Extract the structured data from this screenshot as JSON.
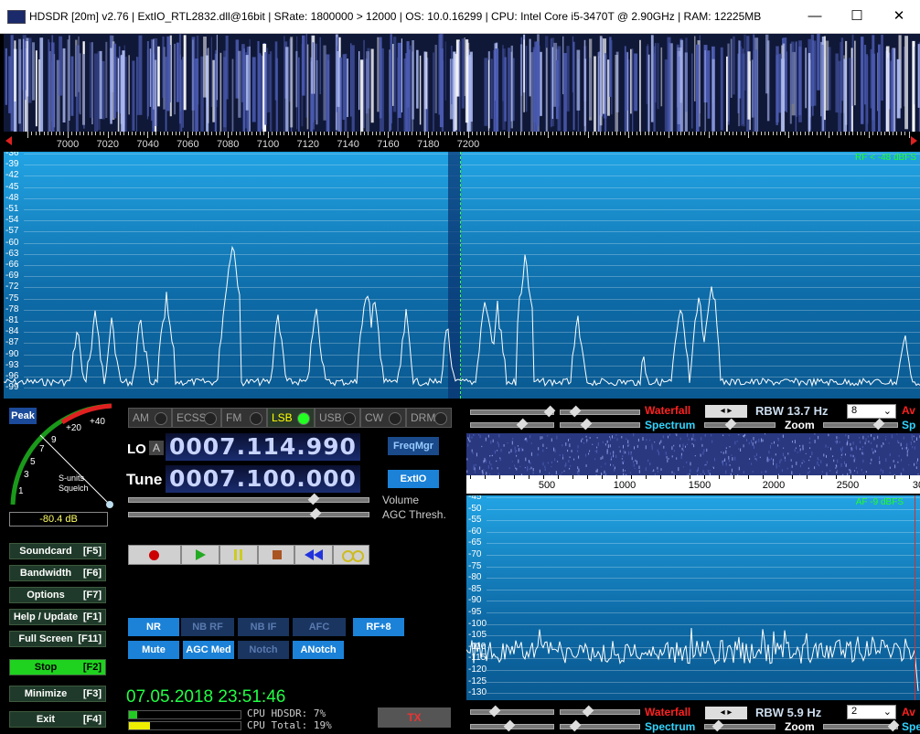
{
  "window": {
    "title": "HDSDR  [20m]  v2.76   |  ExtIO_RTL2832.dll@16bit  |  SRate: 1800000 > 12000  |  OS: 10.0.16299   |  CPU: Intel Core i5-3470T @ 2.90GHz  |  RAM: 12225MB",
    "minimize_glyph": "—",
    "maximize_glyph": "☐",
    "close_glyph": "✕"
  },
  "ruler": {
    "labels": [
      "7000",
      "7020",
      "7040",
      "7060",
      "7080",
      "7100",
      "7120",
      "7140",
      "7160",
      "7180",
      "7200"
    ]
  },
  "spectrum": {
    "rf_level": "RF < -48 dBFS",
    "db_labels": [
      "-36",
      "-39",
      "-42",
      "-45",
      "-48",
      "-51",
      "-54",
      "-57",
      "-60",
      "-63",
      "-66",
      "-69",
      "-72",
      "-75",
      "-78",
      "-81",
      "-84",
      "-87",
      "-90",
      "-93",
      "-96",
      "-99"
    ]
  },
  "smeter": {
    "peak_label": "Peak",
    "scale": [
      "1",
      "3",
      "5",
      "7",
      "9",
      "+20",
      "+40"
    ],
    "caption1": "S-units",
    "caption2": "Squelch",
    "reading": "-80.4 dB"
  },
  "modes": [
    {
      "label": "AM",
      "active": false
    },
    {
      "label": "ECSS",
      "active": false
    },
    {
      "label": "FM",
      "active": false
    },
    {
      "label": "LSB",
      "active": true
    },
    {
      "label": "USB",
      "active": false
    },
    {
      "label": "CW",
      "active": false
    },
    {
      "label": "DRM",
      "active": false
    }
  ],
  "lo": {
    "label": "LO",
    "mode": "A",
    "value": "0007.114.990"
  },
  "tune": {
    "label": "Tune",
    "value": "0007.100.000"
  },
  "buttons": {
    "freqmgr": "FreqMgr",
    "extio": "ExtIO",
    "volume": "Volume",
    "agc_thresh": "AGC Thresh."
  },
  "side_buttons": [
    {
      "label": "Soundcard",
      "key": "[F5]"
    },
    {
      "label": "Bandwidth",
      "key": "[F6]"
    },
    {
      "label": "Options",
      "key": "[F7]"
    },
    {
      "label": "Help / Update",
      "key": "[F1]"
    },
    {
      "label": "Full Screen",
      "key": "[F11]"
    },
    {
      "label": "Stop",
      "key": "[F2]"
    },
    {
      "label": "Minimize",
      "key": "[F3]"
    },
    {
      "label": "Exit",
      "key": "[F4]"
    }
  ],
  "dsp1": [
    "NR",
    "NB RF",
    "NB IF",
    "AFC",
    "RF+8"
  ],
  "dsp2": [
    "Mute",
    "AGC Med",
    "Notch",
    "ANotch"
  ],
  "datetime": "07.05.2018 23:51:46",
  "cpu": {
    "hdsdr": "CPU HDSDR: 7%",
    "total": "CPU Total: 19%",
    "hdsdr_fraction": 0.07,
    "total_fraction": 0.19
  },
  "tx_label": "TX",
  "top_controls": {
    "waterfall": "Waterfall",
    "spectrum": "Spectrum",
    "rbw": "RBW 13.7 Hz",
    "zoom": "Zoom",
    "select_value": "8",
    "av": "Av",
    "sp": "Sp"
  },
  "af": {
    "axis": [
      "500",
      "1000",
      "1500",
      "2000",
      "2500",
      "30"
    ],
    "level": "AF -9 dBFS",
    "db_labels": [
      "-45",
      "-50",
      "-55",
      "-60",
      "-65",
      "-70",
      "-75",
      "-80",
      "-85",
      "-90",
      "-95",
      "-100",
      "-105",
      "-110",
      "-115",
      "-120",
      "-125",
      "-130"
    ]
  },
  "bottom_controls": {
    "waterfall": "Waterfall",
    "spectrum": "Spectrum",
    "rbw": "RBW  5.9 Hz",
    "zoom": "Zoom",
    "select_value": "2",
    "av": "Av",
    "sp": "Spe"
  }
}
